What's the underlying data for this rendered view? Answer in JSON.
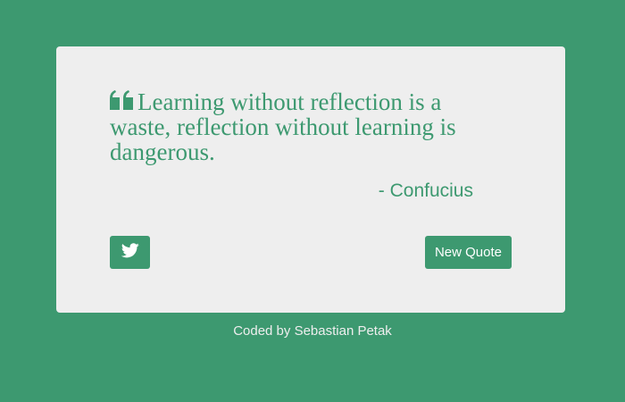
{
  "colors": {
    "background": "#3d9970",
    "card": "#eeeeee",
    "accent": "#3d9970",
    "button_text": "#ffffff"
  },
  "quote": {
    "icon": "quote-left-icon",
    "text": "Learning without reflection is a waste, reflection without learning is dangerous.",
    "author": "- Confucius"
  },
  "buttons": {
    "tweet_icon": "twitter-icon",
    "new_quote_label": "New Quote"
  },
  "footer": {
    "credit": "Coded by Sebastian Petak"
  }
}
